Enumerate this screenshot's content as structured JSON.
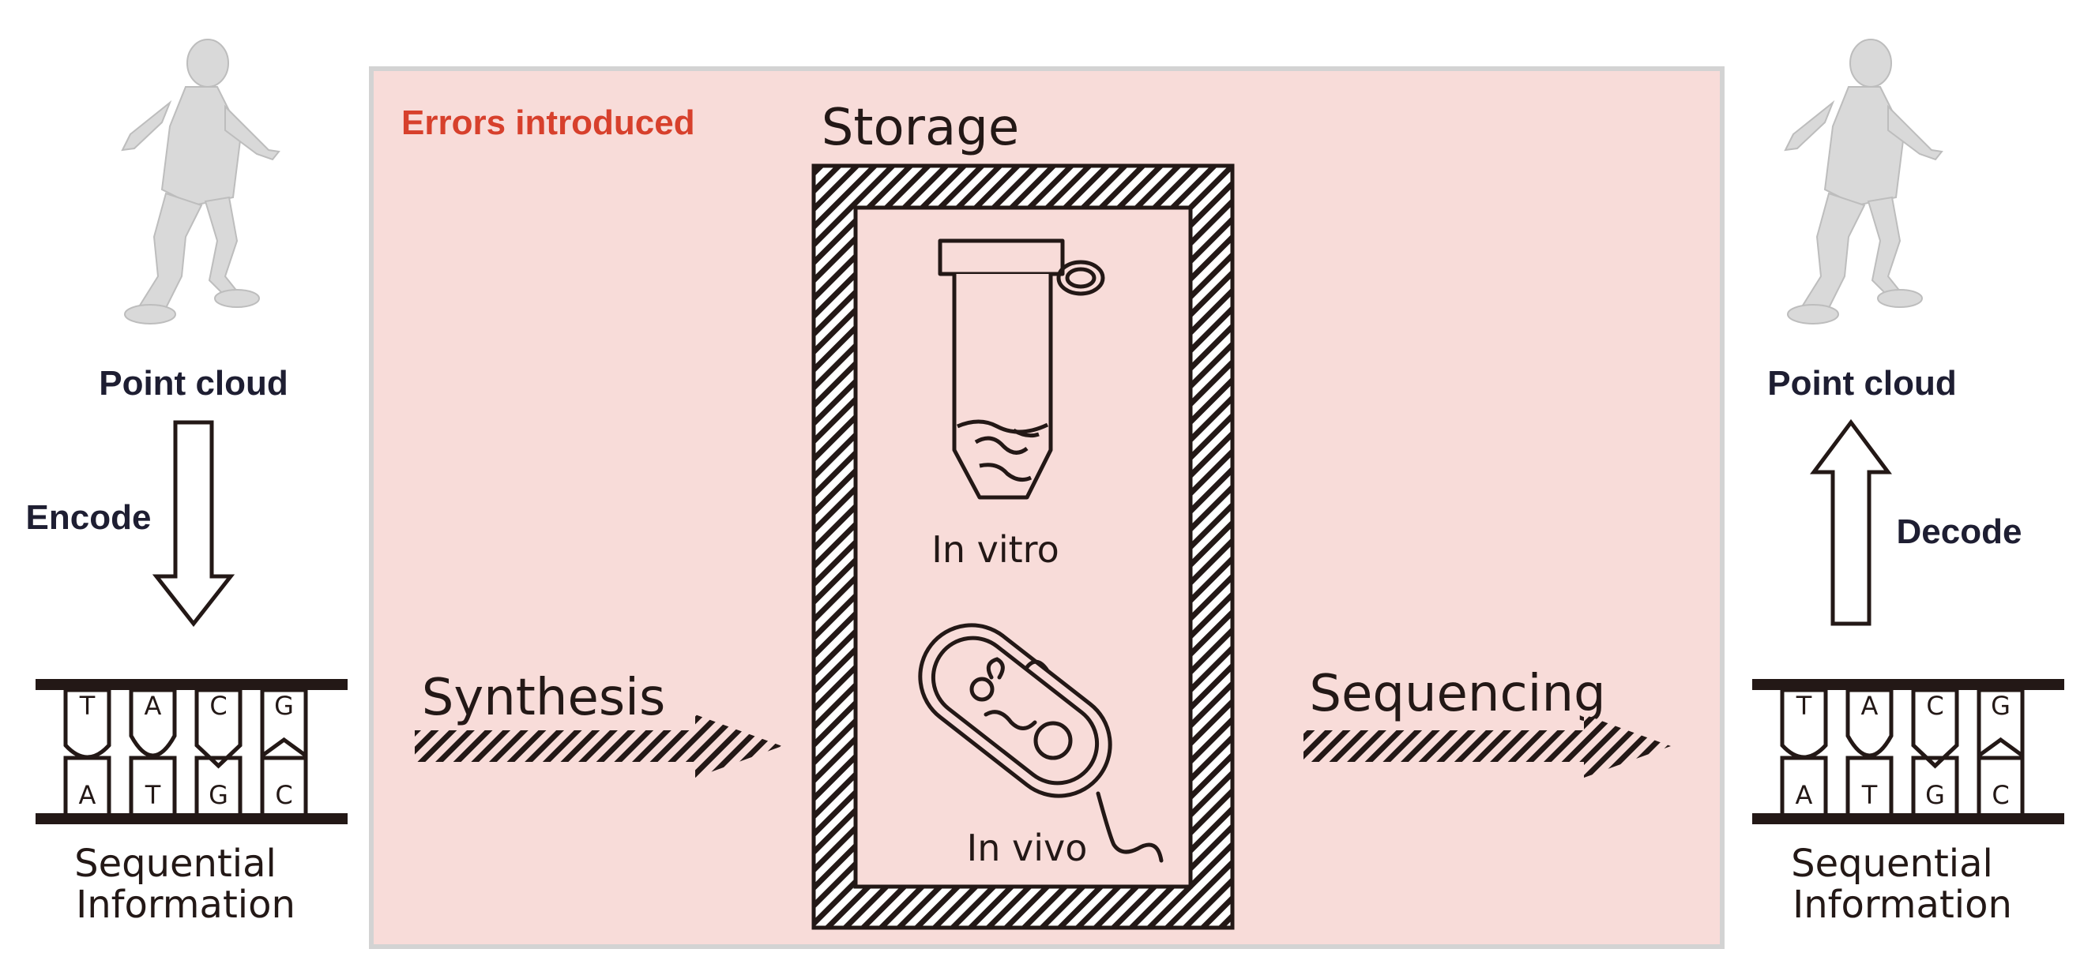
{
  "left": {
    "point_cloud_label": "Point cloud",
    "arrow_label": "Encode",
    "dna": {
      "top_bases": [
        "T",
        "A",
        "C",
        "G"
      ],
      "bottom_bases": [
        "A",
        "T",
        "G",
        "C"
      ]
    },
    "info_label_line1": "Sequential",
    "info_label_line2": "Information"
  },
  "middle": {
    "errors_label": "Errors introduced",
    "storage_label": "Storage",
    "synthesis_label": "Synthesis",
    "sequencing_label": "Sequencing",
    "in_vitro_label": "In vitro",
    "in_vivo_label": "In vivo"
  },
  "right": {
    "point_cloud_label": "Point cloud",
    "arrow_label": "Decode",
    "dna": {
      "top_bases": [
        "T",
        "A",
        "C",
        "G"
      ],
      "bottom_bases": [
        "A",
        "T",
        "G",
        "C"
      ]
    },
    "info_label_line1": "Sequential",
    "info_label_line2": "Information"
  },
  "colors": {
    "panel_fill": "#f8dcd9",
    "panel_border": "#d3d3d3",
    "errors_text": "#d7402c",
    "ink": "#231816",
    "figure": "#d9d9d9"
  },
  "icons": {
    "point_cloud": "human-figure-icon",
    "tube": "test-tube-icon",
    "bacterium": "bacterium-icon"
  }
}
